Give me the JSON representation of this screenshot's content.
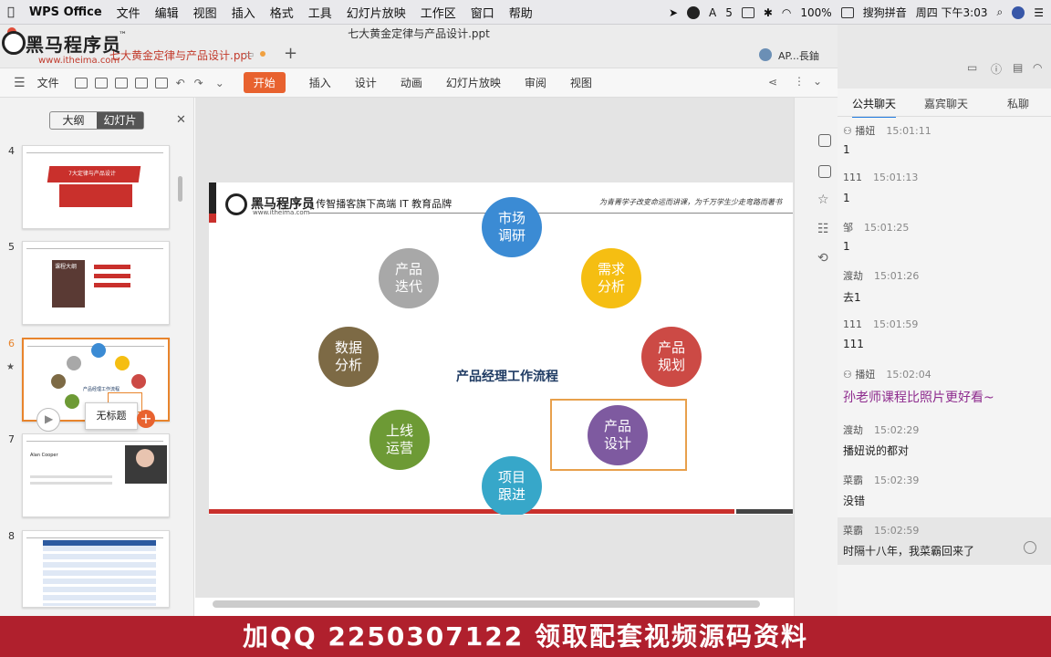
{
  "menubar": {
    "app": "WPS Office",
    "items": [
      "文件",
      "编辑",
      "视图",
      "插入",
      "格式",
      "工具",
      "幻灯片放映",
      "工作区",
      "窗口",
      "帮助"
    ],
    "status": [
      "5",
      "100%",
      "搜狗拼音",
      "周四 下午3:03"
    ]
  },
  "window": {
    "title": "七大黄金定律与产品设计.ppt"
  },
  "tabs": {
    "doc_tab": "七大黄金定律与产品设计.ppt",
    "user": "AP...長鈾"
  },
  "watermark": {
    "name": "黑马程序员",
    "tm": "™",
    "url": "www.itheima.com"
  },
  "ribbon": {
    "file": "文件",
    "tabs": [
      "开始",
      "插入",
      "设计",
      "动画",
      "幻灯片放映",
      "审阅",
      "视图"
    ]
  },
  "leftpane": {
    "seg": [
      "大纲",
      "幻灯片"
    ],
    "thumbs": [
      {
        "num": "4",
        "title": "7大定律与产品设计"
      },
      {
        "num": "5",
        "title": "课程大纲"
      },
      {
        "num": "6",
        "center": "产品经理工作流程"
      },
      {
        "num": "7",
        "text": "Alan Cooper"
      },
      {
        "num": "8"
      }
    ],
    "tooltip": "无标题"
  },
  "slide": {
    "brand": "黑马程序员",
    "brand_url": "www.itheima.com",
    "tagline": "| 传智播客旗下高端 IT 教育品牌",
    "motto": "为青菁学子改变命运而讲课，为千万学生少走弯路而著书",
    "center": "产品经理工作流程",
    "nodes": [
      {
        "label": "市场\n调研",
        "color": "#3b8bd4"
      },
      {
        "label": "需求\n分析",
        "color": "#f5be12"
      },
      {
        "label": "产品\n规划",
        "color": "#cc4a45"
      },
      {
        "label": "产品\n设计",
        "color": "#7e5aa0"
      },
      {
        "label": "项目\n跟进",
        "color": "#37a7c9"
      },
      {
        "label": "上线\n运营",
        "color": "#6d9a35"
      },
      {
        "label": "数据\n分析",
        "color": "#7d6a45"
      },
      {
        "label": "产品\n迭代",
        "color": "#a8a8a8"
      }
    ]
  },
  "chat": {
    "tabs": [
      "公共聊天",
      "嘉宾聊天",
      "私聊"
    ],
    "messages": [
      {
        "user": "播妞",
        "time": "15:01:11",
        "text": "1"
      },
      {
        "user": "111",
        "time": "15:01:13",
        "text": "1"
      },
      {
        "user": "邹",
        "time": "15:01:25",
        "text": "1"
      },
      {
        "user": "渡劫",
        "time": "15:01:26",
        "text": "去1"
      },
      {
        "user": "111",
        "time": "15:01:59",
        "text": "111"
      },
      {
        "user": "播妞",
        "time": "15:02:04",
        "text": "孙老师课程比照片更好看~"
      },
      {
        "user": "渡劫",
        "time": "15:02:29",
        "text": "播妞说的都对"
      },
      {
        "user": "菜霸",
        "time": "15:02:39",
        "text": "没错"
      },
      {
        "user": "菜霸",
        "time": "15:02:59",
        "text": "时隔十八年，我菜霸回来了"
      }
    ]
  },
  "banner": "加QQ 2250307122 领取配套视频源码资料"
}
